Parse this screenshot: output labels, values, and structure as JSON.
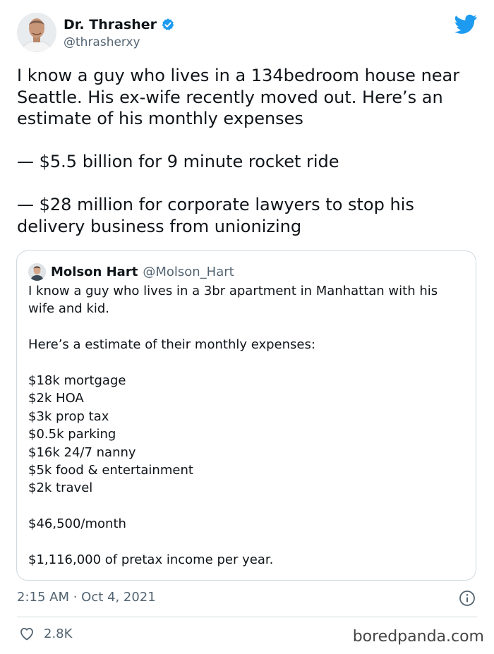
{
  "author": {
    "display_name": "Dr. Thrasher",
    "handle": "@thrasherxy"
  },
  "tweet": {
    "paragraphs": [
      "I know a guy who lives in a 134bedroom house near Seattle. His ex-wife recently moved out. Here’s an estimate of his monthly expenses",
      "— $5.5 billion for 9 minute rocket ride",
      "— $28 million for corporate lawyers to stop his delivery business from unionizing"
    ]
  },
  "quote": {
    "display_name": "Molson Hart",
    "handle": "@Molson_Hart",
    "intro_line1": "I know a guy who lives in a 3br apartment in Manhattan with his",
    "intro_line2": "wife and kid.",
    "estimate_line": "Here’s a estimate of their monthly expenses:",
    "expenses": [
      "$18k mortgage",
      "$2k HOA",
      "$3k prop tax",
      "$0.5k parking",
      "$16k 24/7 nanny",
      "$5k food & entertainment",
      "$2k travel"
    ],
    "total": "$46,500/month",
    "income": "$1,116,000 of pretax income per year."
  },
  "meta": {
    "timestamp": "2:15 AM · Oct 4, 2021"
  },
  "engagement": {
    "likes": "2.8K"
  },
  "watermark": "boredpanda.com",
  "colors": {
    "twitter_blue": "#1d9bf0",
    "text": "#0f1419",
    "secondary_text": "#536471",
    "border": "#cfd9de"
  }
}
